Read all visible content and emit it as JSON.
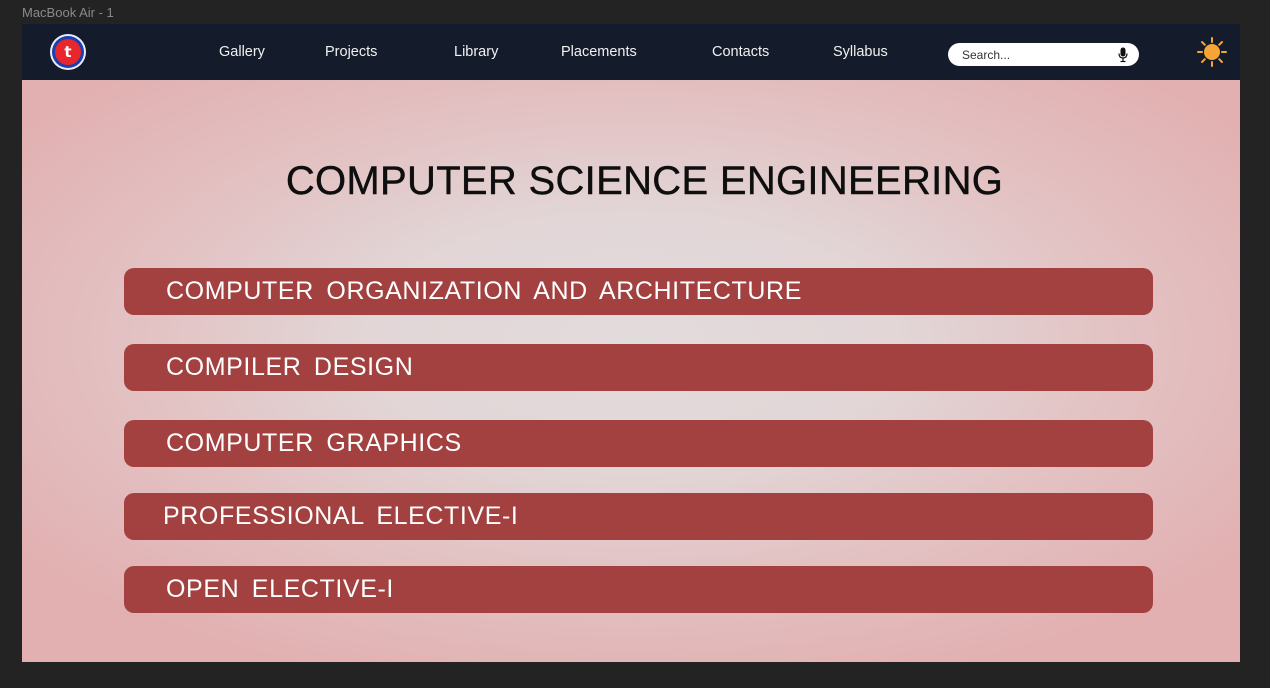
{
  "frame_label": "MacBook Air - 1",
  "logo": {
    "letter": "t",
    "icon": "college-logo-icon"
  },
  "nav": {
    "items": [
      {
        "label": "Gallery"
      },
      {
        "label": "Projects"
      },
      {
        "label": "Library"
      },
      {
        "label": "Placements"
      },
      {
        "label": "Contacts"
      },
      {
        "label": "Syllabus"
      }
    ]
  },
  "search": {
    "placeholder": "Search...",
    "icon": "mic-icon"
  },
  "theme_toggle": {
    "icon": "sun-icon"
  },
  "main": {
    "title": "COMPUTER SCIENCE ENGINEERING",
    "subjects": [
      {
        "label": "COMPUTER ORGANIZATION AND ARCHITECTURE"
      },
      {
        "label": "COMPILER DESIGN"
      },
      {
        "label": "COMPUTER GRAPHICS"
      },
      {
        "label": "PROFESSIONAL ELECTIVE-I"
      },
      {
        "label": "OPEN ELECTIVE-I"
      }
    ]
  },
  "colors": {
    "background": "#232323",
    "navbar": "#141c2b",
    "page": "#e3b0b1",
    "subject_button": "#a34141",
    "sun": "#f5a536"
  }
}
